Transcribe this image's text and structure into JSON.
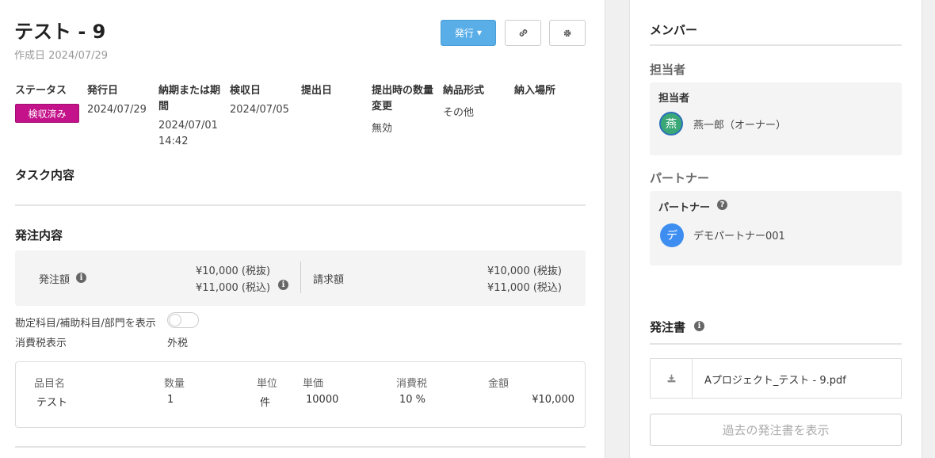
{
  "header": {
    "title": "テスト - 9",
    "created": "作成日 2024/07/29",
    "issue_button": "発行"
  },
  "meta": {
    "status_label": "ステータス",
    "status_value": "検収済み",
    "issue_date_label": "発行日",
    "issue_date": "2024/07/29",
    "deadline_label_1": "納期または期",
    "deadline_label_2": "間",
    "deadline_line_1": "2024/07/01",
    "deadline_line_2": "14:42",
    "acceptance_label": "検収日",
    "acceptance_date": "2024/07/05",
    "submit_label": "提出日",
    "qty_change_label_1": "提出時の数量",
    "qty_change_label_2": "変更",
    "qty_change_value": "無効",
    "delivery_format_label": "納品形式",
    "delivery_format_value": "その他",
    "delivery_place_label": "納入場所"
  },
  "task": {
    "heading": "タスク内容"
  },
  "order": {
    "heading": "発注内容",
    "amount_label": "発注額",
    "amount_excl": "¥10,000 (税抜)",
    "amount_incl": "¥11,000 (税込)",
    "invoice_label": "請求額",
    "invoice_excl": "¥10,000 (税抜)",
    "invoice_incl": "¥11,000 (税込)",
    "account_toggle_label": "勘定科目/補助科目/部門を表示",
    "tax_display_label": "消費税表示",
    "tax_display_value": "外税"
  },
  "items_table": {
    "headers": [
      "品目名",
      "数量",
      "単位",
      "単価",
      "消費税",
      "金額"
    ],
    "rows": [
      [
        "テスト",
        "1",
        "件",
        "10000",
        "10 %",
        "¥10,000"
      ]
    ]
  },
  "sidebar": {
    "members_heading": "メンバー",
    "assignee_section": "担当者",
    "assignee_box_label": "担当者",
    "assignee_avatar": "燕",
    "assignee_name": "燕一郎（オーナー）",
    "partner_section": "パートナー",
    "partner_box_label": "パートナー",
    "partner_avatar": "デ",
    "partner_name": "デモパートナー001",
    "po_heading": "発注書",
    "po_file": "Aプロジェクト_テスト - 9.pdf",
    "past_button": "過去の発注書を表示"
  },
  "colors": {
    "primary": "#5aaee8",
    "status_badge": "#c4138a",
    "assignee_avatar": "#3aa876",
    "partner_avatar": "#3d8ef0"
  }
}
